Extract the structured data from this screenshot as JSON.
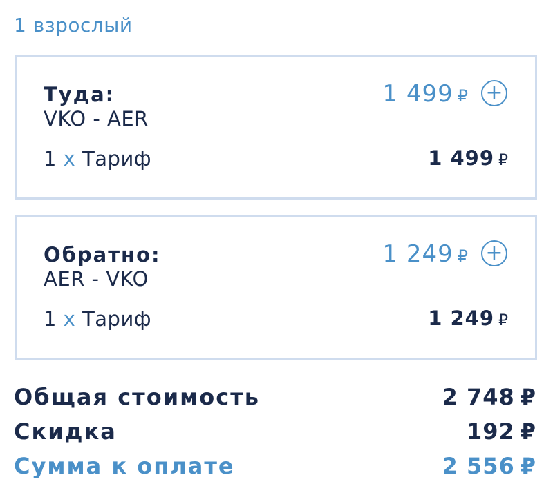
{
  "passengers_label": "1 взрослый",
  "currency_symbol": "₽",
  "segments": [
    {
      "label": "Туда:",
      "route": "VKO - AER",
      "price": "1 499",
      "fare_qty": "1",
      "fare_x": "x",
      "fare_name": "Тариф",
      "fare_price": "1 499"
    },
    {
      "label": "Обратно:",
      "route": "AER - VKO",
      "price": "1 249",
      "fare_qty": "1",
      "fare_x": "x",
      "fare_name": "Тариф",
      "fare_price": "1 249"
    }
  ],
  "totals": {
    "total_label": "Общая стоимость",
    "total_value": "2 748",
    "discount_label": "Скидка",
    "discount_value": "192",
    "pay_label": "Сумма к оплате",
    "pay_value": "2 556"
  },
  "colors": {
    "accent": "#4a90c8",
    "text": "#1b2a4a",
    "border": "#cfdcee"
  },
  "icons": {
    "add": "plus-circle-icon"
  }
}
